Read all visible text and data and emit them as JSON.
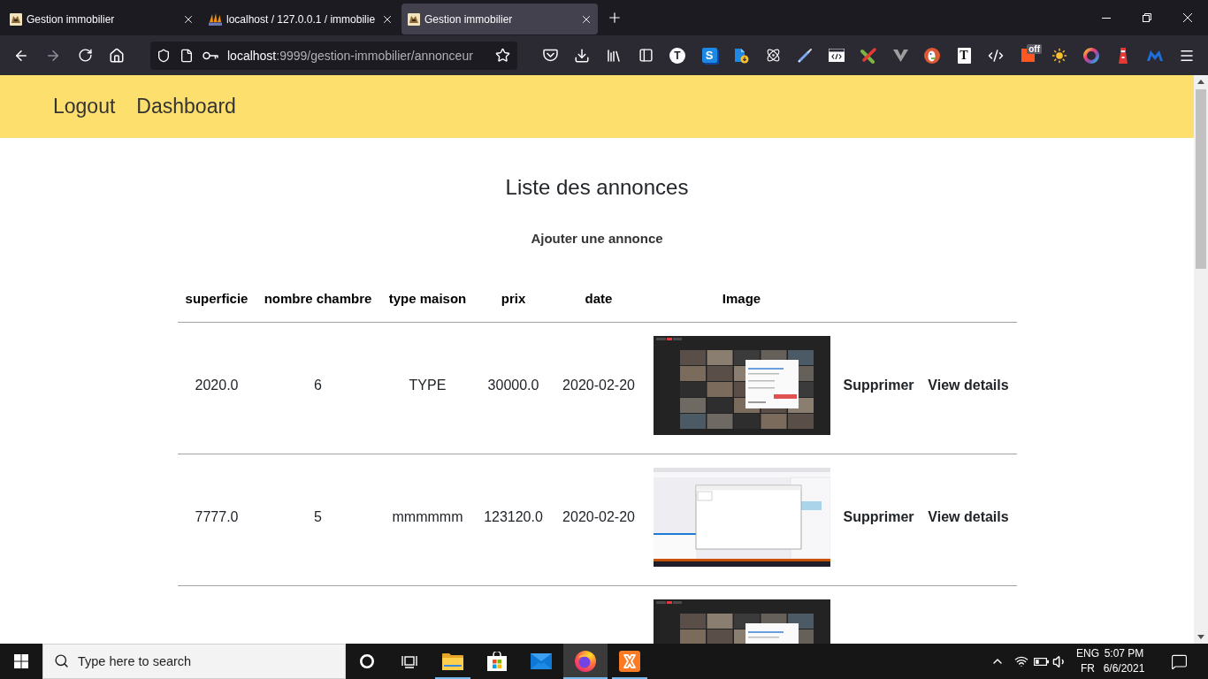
{
  "browser": {
    "tabs": [
      {
        "title": "Gestion immobilier",
        "selected": false,
        "kind": "app"
      },
      {
        "title": "localhost / 127.0.0.1 / immobilie",
        "selected": false,
        "kind": "db-admin"
      },
      {
        "title": "Gestion immobilier",
        "selected": true,
        "kind": "app"
      }
    ],
    "address": {
      "host": "localhost",
      "path": ":9999/gestion-immobilier/annonceur"
    },
    "forward_disabled": true,
    "extension_glyphs": [
      "T",
      "S",
      "T"
    ],
    "extension_badge": "off"
  },
  "nav": {
    "links": [
      "Logout",
      "Dashboard"
    ]
  },
  "page": {
    "title": "Liste des annonces",
    "add_link": "Ajouter une annonce"
  },
  "table": {
    "columns": [
      "superficie",
      "nombre chambre",
      "type maison",
      "prix",
      "date",
      "Image"
    ],
    "rows": [
      {
        "cells": [
          "2020.0",
          "6",
          "TYPE",
          "30000.0",
          "2020-02-20"
        ],
        "image": {
          "kind": "video-call"
        },
        "actions": [
          "Supprimer",
          "View details"
        ]
      },
      {
        "cells": [
          "7777.0",
          "5",
          "mmmmmm",
          "123120.0",
          "2020-02-20"
        ],
        "image": {
          "kind": "app-screenshot"
        },
        "actions": [
          "Supprimer",
          "View details"
        ]
      },
      {
        "image": {
          "kind": "video-call"
        }
      }
    ]
  },
  "taskbar": {
    "search": {
      "placeholder": "Type here to search"
    },
    "apps": [
      {
        "kind": "files",
        "running": true,
        "selected": false
      },
      {
        "kind": "store",
        "running": false,
        "selected": false
      },
      {
        "kind": "mail",
        "running": false,
        "selected": false
      },
      {
        "kind": "browser",
        "running": true,
        "selected": true
      },
      {
        "kind": "server",
        "running": true,
        "selected": false
      }
    ],
    "tray": {
      "language": "ENG",
      "layout": "FR",
      "time": "5:07 PM",
      "date": "6/6/2021"
    }
  }
}
